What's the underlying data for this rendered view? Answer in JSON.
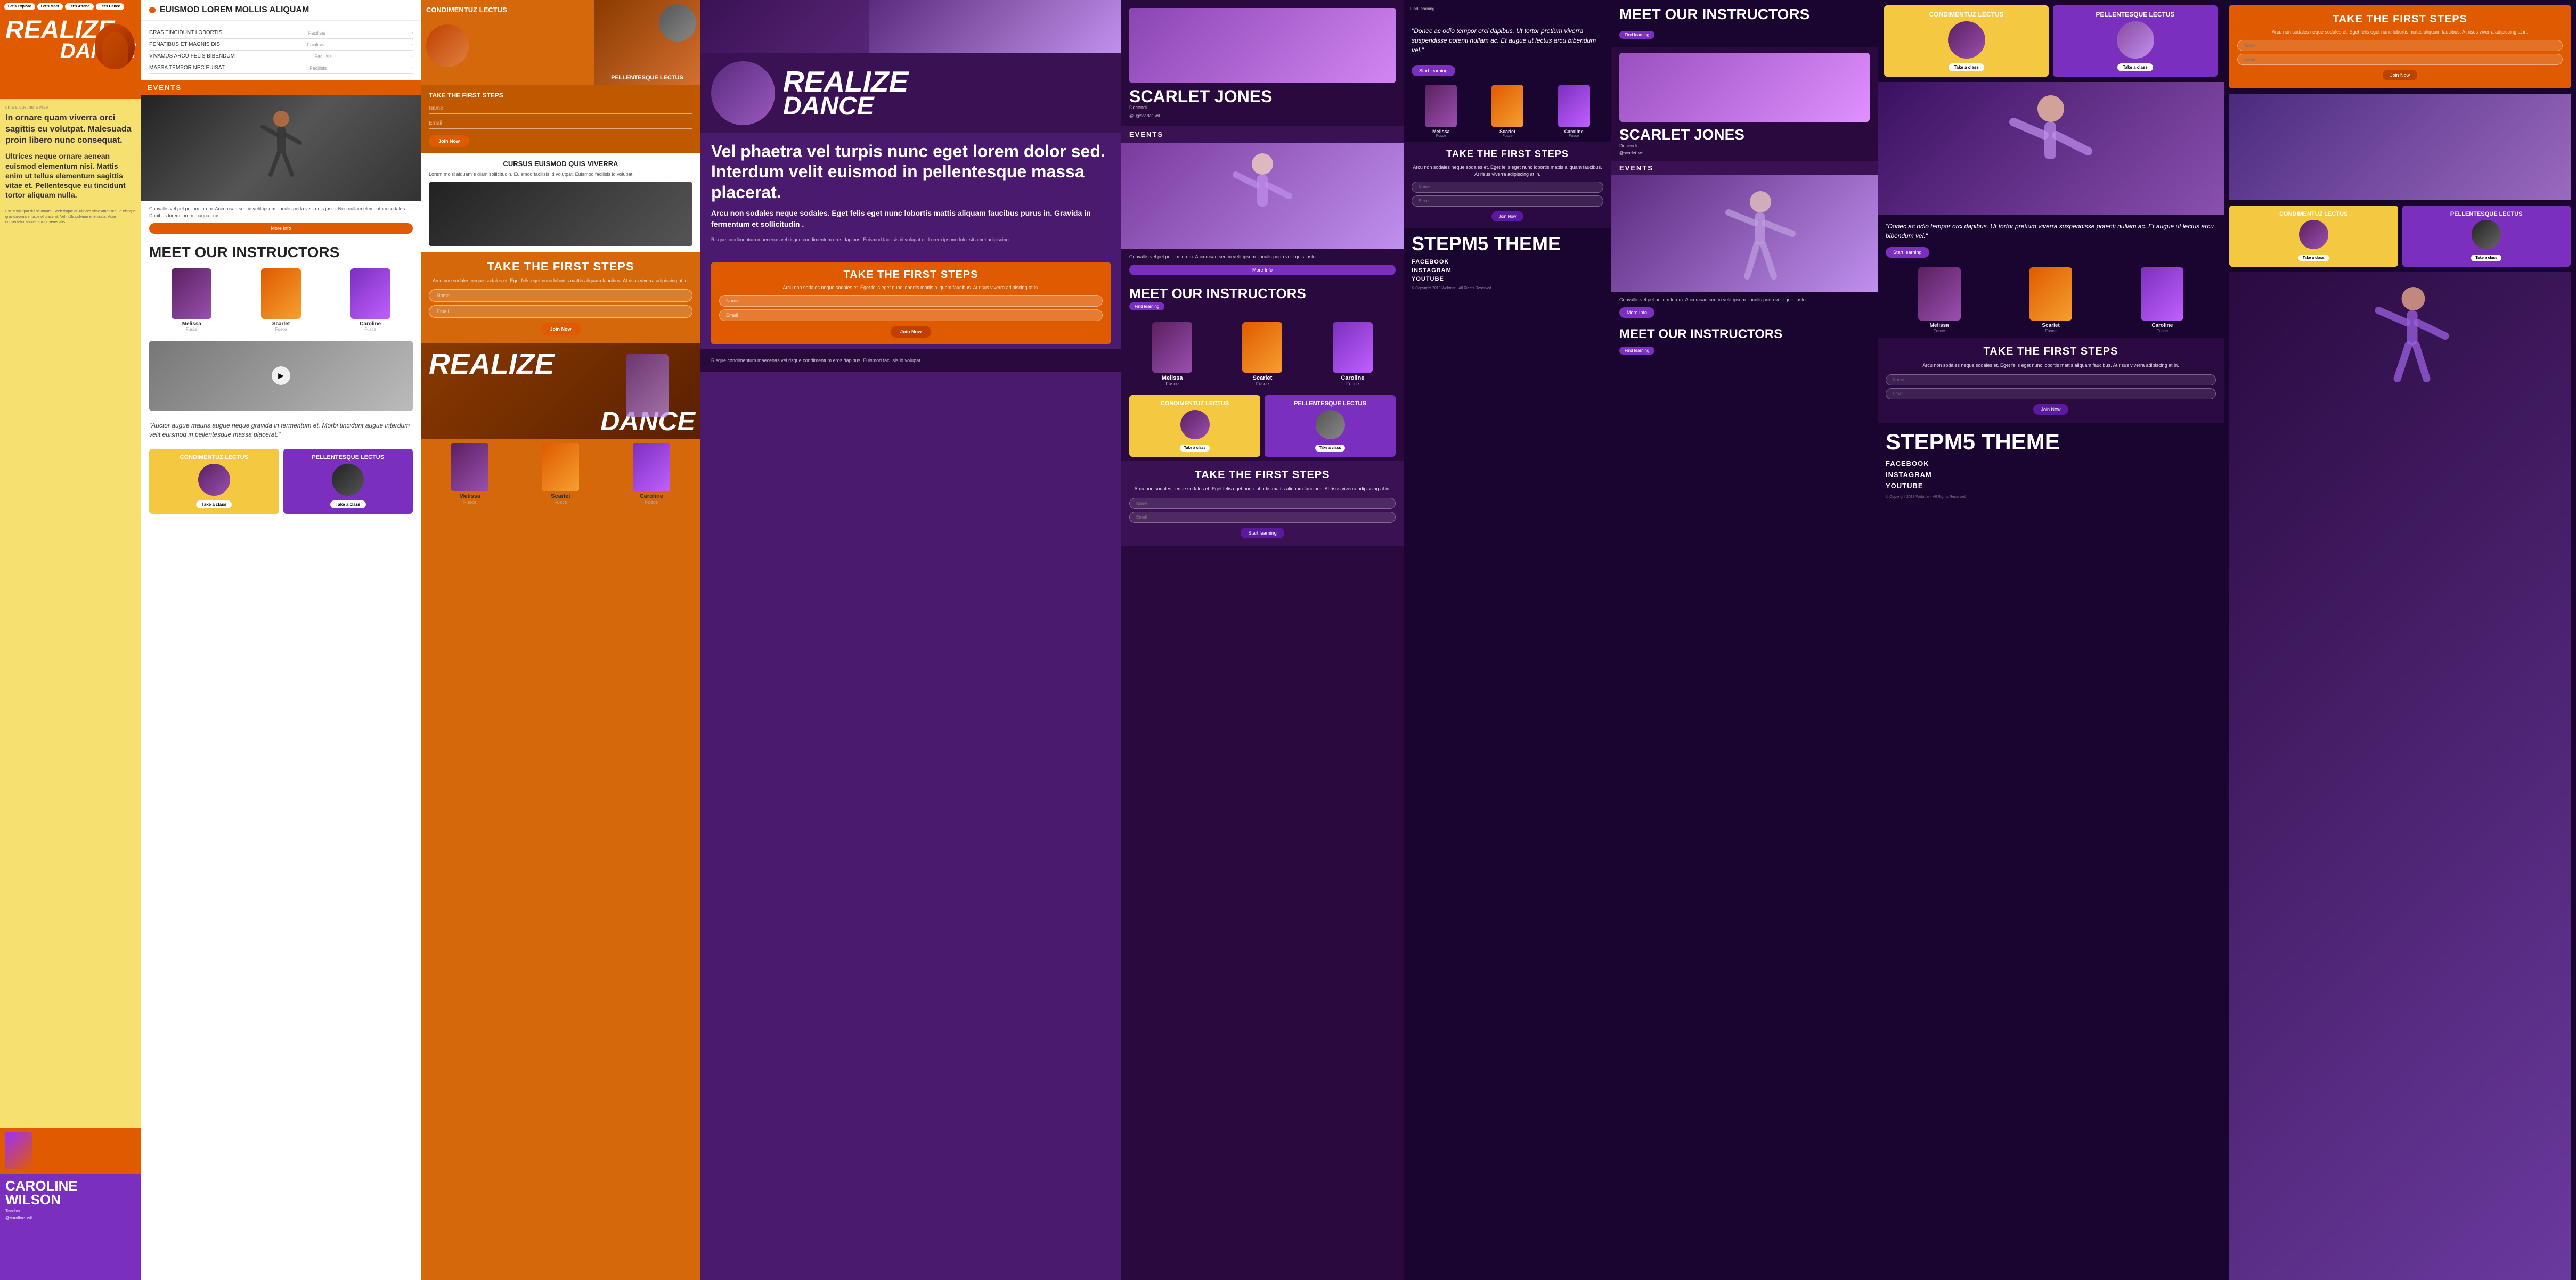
{
  "nav": {
    "buttons": [
      "Let's Explore",
      "Let's Meet",
      "Let's Attend",
      "Let's Dance"
    ]
  },
  "brand": {
    "realize": "REALIZE",
    "dance": "DANCE",
    "logo_text": "EUISMOD LOREM MOLLIS ALIQUAM"
  },
  "hero": {
    "body_text_1": "In ornare quam viverra orci sagittis eu volutpat. Malesuada proin libero nunc consequat.",
    "body_text_2": "Ultrices neque ornare aenean euismod elementum nisi. Mattis enim ut tellus elementum sagittis vitae et. Pellentesque eu tincidunt tortor aliquam nulla.",
    "footer_small": "Est ut volutpat dui sit ornare. Scelerisque eu ultrices vitae amet sed. In tristique gravida-ornare fusce of placerat. Vel nulla pulvinar et et nulla. Vitae consectetur aliquet auctor venenatis."
  },
  "sections": {
    "events": "EVENTS",
    "meet_instructors": "MEET OUR INSTRUCTORS",
    "take_first_steps": "TAKE THE FIRST STEPS",
    "find_learning": "Find learning",
    "cursus_title": "CURSUS EUISMOD QUIS VIVERRA",
    "cursus_body": "Lorem molsi alquam e diam sollicitudin. Euismod facilisis id volutpat. Euismod facilisis id volupat."
  },
  "instructors": {
    "melissa": "Melissa",
    "scarlet": "Scarlet",
    "caroline": "Caroline",
    "melissa_tag": "Fusce",
    "scarlet_tag": "Fusce",
    "caroline_tag": "Fusce"
  },
  "caroline_wilson": {
    "name": "CAROLINE WILSON",
    "tag": "Teacher",
    "social": "@caroline_wil"
  },
  "scarlet_jones": {
    "name": "SCARLET JONES",
    "tag": "Docendi",
    "social": "@scarlet_wil"
  },
  "form": {
    "fields": [
      "CRAS TINCIDUNT LOBORTIS",
      "PENATIBUS ET MAGNIS DIS",
      "VIVAMUS ARCU FELIS BIBENDUM",
      "MASSA TEMPOR NEC EUISAT"
    ],
    "field_values": [
      "Facilisis",
      "Facilisis",
      "Facilisis",
      "Facilisis"
    ],
    "name_placeholder": "Name",
    "email_placeholder": "Email"
  },
  "quote": {
    "text1": "\"Auctor augue mauris augue neque gravida in fermentum et. Morbi tincidunt augue interdum velit euismod in pellentesque massa placerat.\"",
    "text2": "\"Donec ac odio tempor orci dapibus. Ut tortor pretium viverra suspendisse potenti nullam ac. Et augue ut lectus arcu bibendum vel.\""
  },
  "steps": {
    "body": "Arcu non sodales neque sodales et. Eget felis eget nunc lobortis mattis aliquam faucibus. At risus viverra adipiscing at in.",
    "name_placeholder": "Name",
    "email_placeholder": "Email",
    "join_btn": "Join Now",
    "start_btn": "Start learning"
  },
  "cards": {
    "card1_title": "CONDIMENTUZ LECTUS",
    "card2_title": "PELLENTESQUE LECTUS"
  },
  "velp": {
    "text": "Vel phaetra vel turpis nunc eget lorem dolor sed. Interdum velit euismod in pellentesque massa placerat.",
    "text2": "Arcu non sodales neque sodales. Eget felis eget nunc lobortis mattis aliquam faucibus purus in. Gravida in fermentum et sollicitudin ."
  },
  "stepm5": {
    "brand": "STEPM5 THEME"
  },
  "footer": {
    "links": [
      "FACEBOOK",
      "INSTAGRAM",
      "YOUTUBE"
    ],
    "copyright": "© Copyright 2019 Webinar - All Rights Reserved"
  }
}
